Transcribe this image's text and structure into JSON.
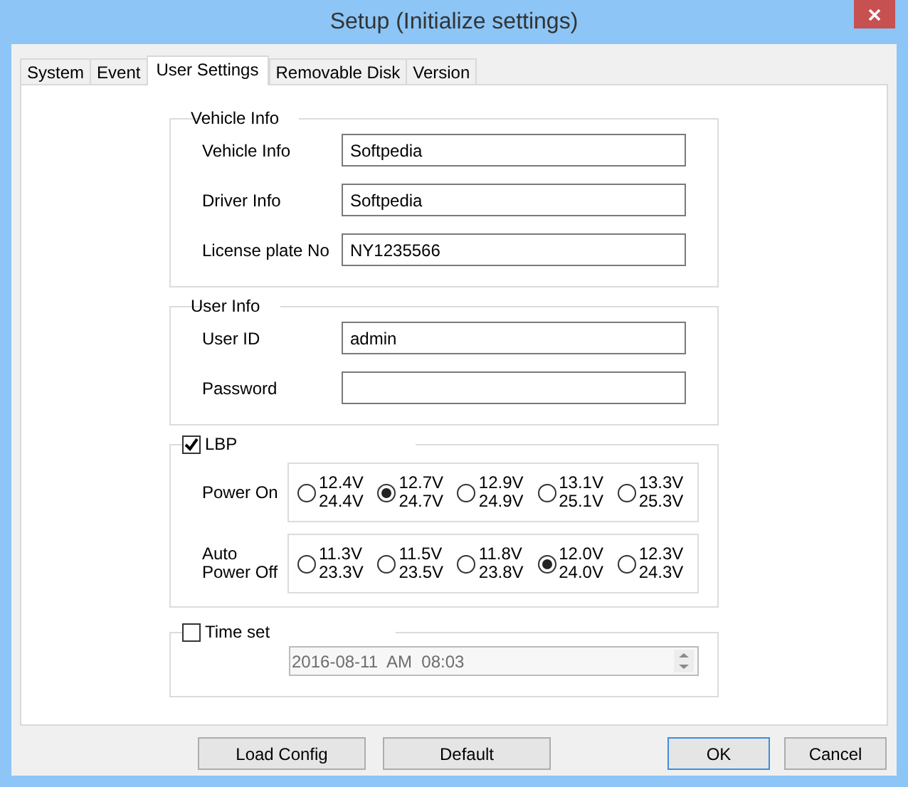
{
  "window": {
    "title": "Setup (Initialize settings)"
  },
  "tabs": [
    {
      "label": "System",
      "selected": false
    },
    {
      "label": "Event",
      "selected": false
    },
    {
      "label": "User Settings",
      "selected": true
    },
    {
      "label": "Removable Disk",
      "selected": false
    },
    {
      "label": "Version",
      "selected": false
    }
  ],
  "vehicle_info": {
    "legend": "Vehicle Info",
    "fields": [
      {
        "label": "Vehicle Info",
        "value": "Softpedia"
      },
      {
        "label": "Driver Info",
        "value": "Softpedia"
      },
      {
        "label": "License plate No",
        "value": "NY1235566"
      }
    ]
  },
  "user_info": {
    "legend": "User Info",
    "fields": [
      {
        "label": "User ID",
        "value": "admin"
      },
      {
        "label": "Password"
      }
    ]
  },
  "lbp": {
    "label": "LBP",
    "checked": true,
    "rows": [
      {
        "label": "Power On",
        "options": [
          {
            "upper": "12.4V",
            "lower": "24.4V",
            "selected": false
          },
          {
            "upper": "12.7V",
            "lower": "24.7V",
            "selected": true
          },
          {
            "upper": "12.9V",
            "lower": "24.9V",
            "selected": false
          },
          {
            "upper": "13.1V",
            "lower": "25.1V",
            "selected": false
          },
          {
            "upper": "13.3V",
            "lower": "25.3V",
            "selected": false
          }
        ]
      },
      {
        "label": "Auto Power Off",
        "options": [
          {
            "upper": "11.3V",
            "lower": "23.3V",
            "selected": false
          },
          {
            "upper": "11.5V",
            "lower": "23.5V",
            "selected": false
          },
          {
            "upper": "11.8V",
            "lower": "23.8V",
            "selected": false
          },
          {
            "upper": "12.0V",
            "lower": "24.0V",
            "selected": true
          },
          {
            "upper": "12.3V",
            "lower": "24.3V",
            "selected": false
          }
        ]
      }
    ]
  },
  "time_set": {
    "label": "Time set",
    "checked": false,
    "value": "2016-08-11  AM  08:03",
    "disabled": true
  },
  "buttons": [
    {
      "label": "Load Config",
      "default": false
    },
    {
      "label": "Default",
      "default": false
    },
    {
      "label": "OK",
      "default": true
    },
    {
      "label": "Cancel",
      "default": false
    }
  ]
}
